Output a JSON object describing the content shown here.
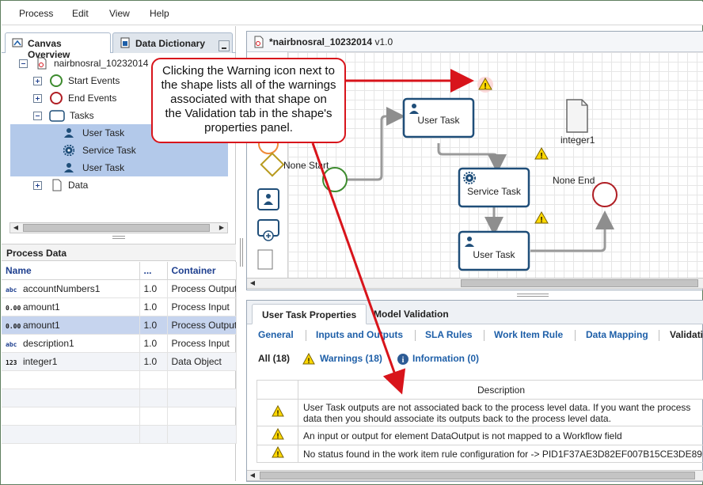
{
  "menu": [
    "Process",
    "Edit",
    "View",
    "Help"
  ],
  "left_tabs": {
    "canvas_overview": "Canvas Overview",
    "data_dictionary": "Data Dictionary"
  },
  "tree": {
    "root": "nairbnosral_10232014",
    "start_events": "Start Events",
    "end_events": "End Events",
    "tasks": "Tasks",
    "task_items": [
      "User Task",
      "Service Task",
      "User Task"
    ],
    "data": "Data"
  },
  "process_data": {
    "title": "Process Data",
    "columns": [
      "Name",
      "...",
      "Container"
    ],
    "rows": [
      {
        "type": "abc",
        "name": "accountNumbers1",
        "version": "1.0",
        "container": "Process Output"
      },
      {
        "type": "0.00",
        "name": "amount1",
        "version": "1.0",
        "container": "Process Input"
      },
      {
        "type": "0.00",
        "name": "amount1",
        "version": "1.0",
        "container": "Process Output"
      },
      {
        "type": "abc",
        "name": "description1",
        "version": "1.0",
        "container": "Process Input"
      },
      {
        "type": "123",
        "name": "integer1",
        "version": "1.0",
        "container": "Data Object"
      }
    ]
  },
  "canvas": {
    "title": "*nairbnosral_10232014",
    "version": "v1.0",
    "shapes": {
      "user_task_1": "User Task",
      "service_task": "Service Task",
      "user_task_2": "User Task",
      "none_start": "None Start",
      "none_end": "None End",
      "data_object": "integer1"
    }
  },
  "callout": "Clicking the Warning icon next to the shape lists all of the warnings associated with that shape on the Validation tab in the shape's properties panel.",
  "properties": {
    "tabs": [
      "User Task Properties",
      "Model Validation"
    ],
    "links": [
      "General",
      "Inputs and Outputs",
      "SLA Rules",
      "Work Item Rule",
      "Data Mapping",
      "Validati"
    ],
    "filters": {
      "all": "All (18)",
      "warnings": "Warnings (18)",
      "information": "Information (0)"
    },
    "description_header": "Description",
    "issues": [
      "User Task outputs are not associated back to the process level data. If you want the process data then you should associate its outputs back to the process level data.",
      "An input or output for element DataOutput is not mapped to a Workflow field",
      "No status found in the work item rule configuration for -> PID1F37AE3D82EF007B15CE3DE89"
    ]
  },
  "colors": {
    "accent_red": "#d8141b",
    "link_blue": "#1e5fa8",
    "shape_blue": "#1f4e79",
    "warning_yellow": "#ffd800"
  }
}
